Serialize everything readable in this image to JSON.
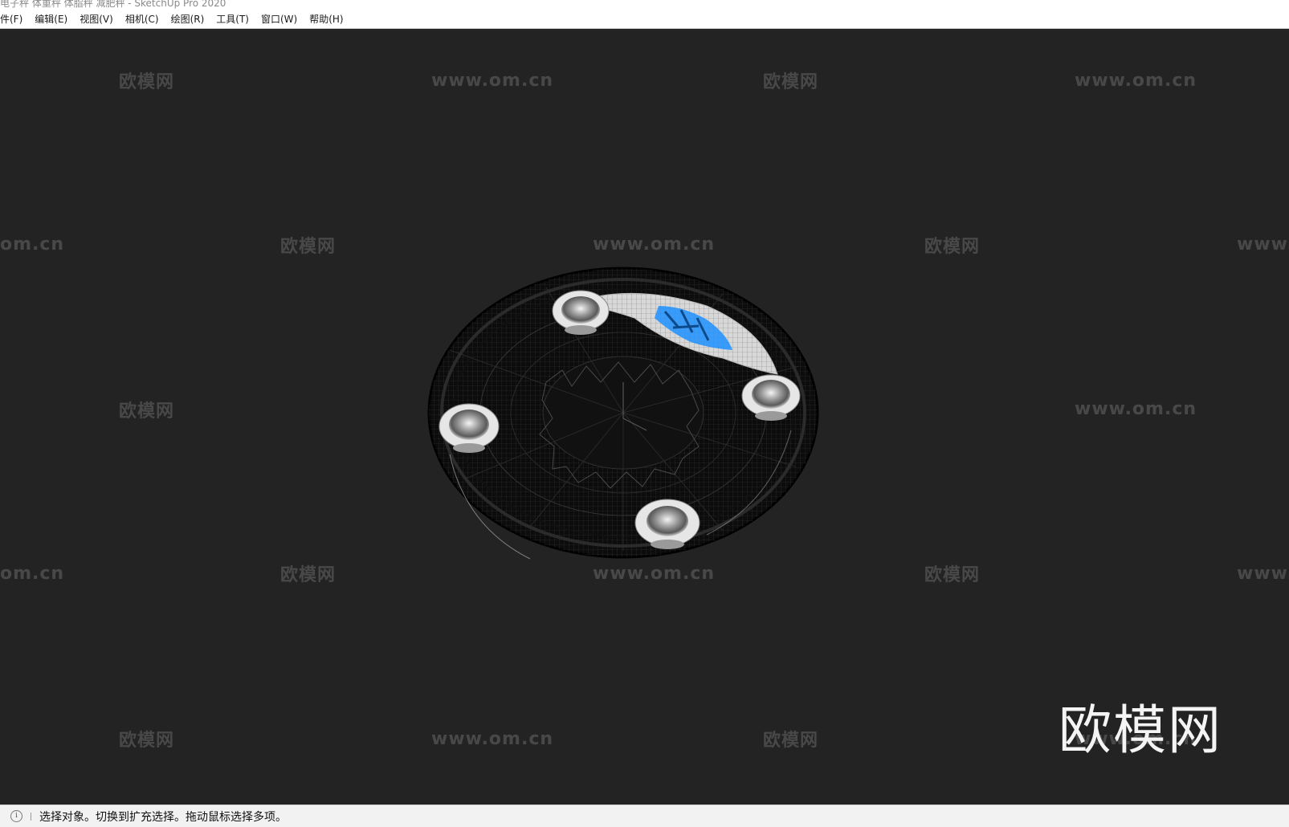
{
  "window": {
    "title": "电子秤 体重秤 体脂秤 减肥秤 - SketchUp Pro 2020"
  },
  "menu": {
    "items": [
      "件(F)",
      "编辑(E)",
      "视图(V)",
      "相机(C)",
      "绘图(R)",
      "工具(T)",
      "窗口(W)",
      "帮助(H)"
    ]
  },
  "watermark": {
    "logo_text": "欧模网",
    "url_text": "www.om.cn",
    "url_partial_left": "om.cn",
    "url_partial_right": "www.",
    "large_logo": "欧模网"
  },
  "status": {
    "icon": "info-icon",
    "message": "选择对象。切换到扩充选择。拖动鼠标选择多项。"
  },
  "colors": {
    "viewport_bg": "#232323",
    "model_display": "#1e90ff"
  }
}
